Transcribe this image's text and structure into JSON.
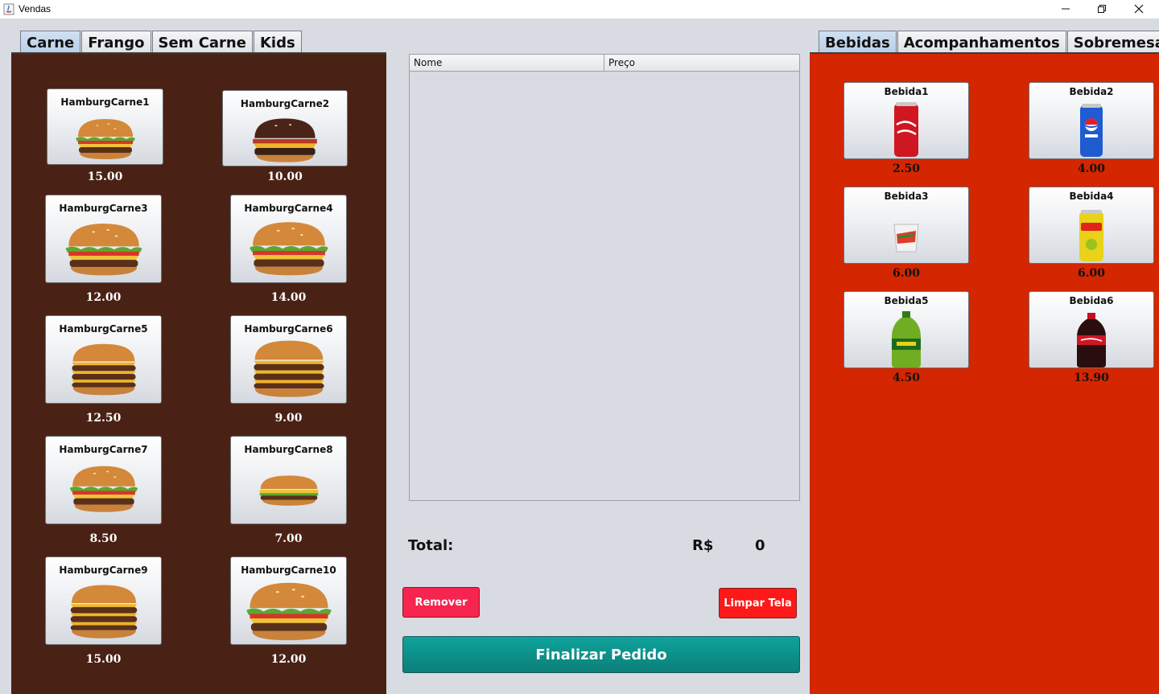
{
  "window": {
    "title": "Vendas"
  },
  "left_tabs": [
    {
      "label": "Carne",
      "active": true
    },
    {
      "label": "Frango",
      "active": false
    },
    {
      "label": "Sem Carne",
      "active": false
    },
    {
      "label": "Kids",
      "active": false
    }
  ],
  "right_tabs": [
    {
      "label": "Bebidas",
      "active": true
    },
    {
      "label": "Acompanhamentos",
      "active": false
    },
    {
      "label": "Sobremesas",
      "active": false
    }
  ],
  "burgers": [
    {
      "name": "HamburgCarne1",
      "price": "15.00"
    },
    {
      "name": "HamburgCarne2",
      "price": "10.00"
    },
    {
      "name": "HamburgCarne3",
      "price": "12.00"
    },
    {
      "name": "HamburgCarne4",
      "price": "14.00"
    },
    {
      "name": "HamburgCarne5",
      "price": "12.50"
    },
    {
      "name": "HamburgCarne6",
      "price": "9.00"
    },
    {
      "name": "HamburgCarne7",
      "price": "8.50"
    },
    {
      "name": "HamburgCarne8",
      "price": "7.00"
    },
    {
      "name": "HamburgCarne9",
      "price": "15.00"
    },
    {
      "name": "HamburgCarne10",
      "price": "12.00"
    }
  ],
  "drinks": [
    {
      "name": "Bebida1",
      "price": "2.50",
      "icon": "coca-cola-can-icon",
      "color": "#d01622"
    },
    {
      "name": "Bebida2",
      "price": "4.00",
      "icon": "pepsi-can-icon",
      "color": "#1f5bd1"
    },
    {
      "name": "Bebida3",
      "price": "6.00",
      "icon": "guarana-cup-icon",
      "color": "#e33a2a"
    },
    {
      "name": "Bebida4",
      "price": "6.00",
      "icon": "lipton-can-icon",
      "color": "#e8d21a"
    },
    {
      "name": "Bebida5",
      "price": "4.50",
      "icon": "guarana-bottle-icon",
      "color": "#5aa21e"
    },
    {
      "name": "Bebida6",
      "price": "13.90",
      "icon": "coca-cola-bottle-icon",
      "color": "#2a0e0e"
    }
  ],
  "order_table": {
    "columns": [
      "Nome",
      "Preço"
    ],
    "rows": []
  },
  "total": {
    "label": "Total:",
    "currency": "R$",
    "value": "0"
  },
  "buttons": {
    "remover": "Remover",
    "limpar": "Limpar Tela",
    "finalizar": "Finalizar Pedido"
  },
  "colors": {
    "left_panel": "#4a2215",
    "right_panel": "#d42600",
    "remover": "#f5254f",
    "limpar": "#ff1818",
    "finalizar": "#0fa39b"
  }
}
